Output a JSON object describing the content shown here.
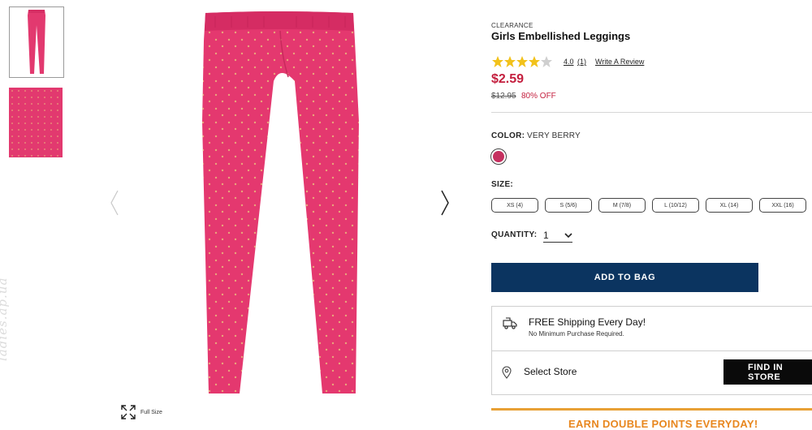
{
  "product": {
    "eyebrow": "CLEARANCE",
    "title": "Girls Embellished Leggings",
    "rating": {
      "value": "4.0",
      "count": "(1)",
      "stars_filled": 4,
      "stars_total": 5,
      "write_review": "Write A Review"
    },
    "price": "$2.59",
    "old_price": "$12.95",
    "discount": "80% OFF"
  },
  "color": {
    "label": "COLOR:",
    "value": "VERY BERRY",
    "swatch_hex": "#c5305f"
  },
  "size": {
    "label": "SIZE:",
    "options": [
      "XS (4)",
      "S (5/6)",
      "M (7/8)",
      "L (10/12)",
      "XL (14)",
      "XXL (16)"
    ]
  },
  "quantity": {
    "label": "QUANTITY:",
    "value": "1"
  },
  "add_to_bag": "ADD TO BAG",
  "shipping": {
    "title": "FREE Shipping Every Day!",
    "subtitle": "No Minimum Purchase Required."
  },
  "store": {
    "label": "Select Store",
    "button": "FIND IN STORE"
  },
  "promo": "EARN DOUBLE POINTS EVERYDAY!",
  "gallery": {
    "full_size_label": "Full Size",
    "product_color": "#e2396f"
  },
  "watermark": "ladies.ap.ua",
  "colors": {
    "navy": "#0b3460",
    "sale_red": "#c41f3e",
    "promo_orange": "#e8871f",
    "star": "#f2c21b"
  }
}
